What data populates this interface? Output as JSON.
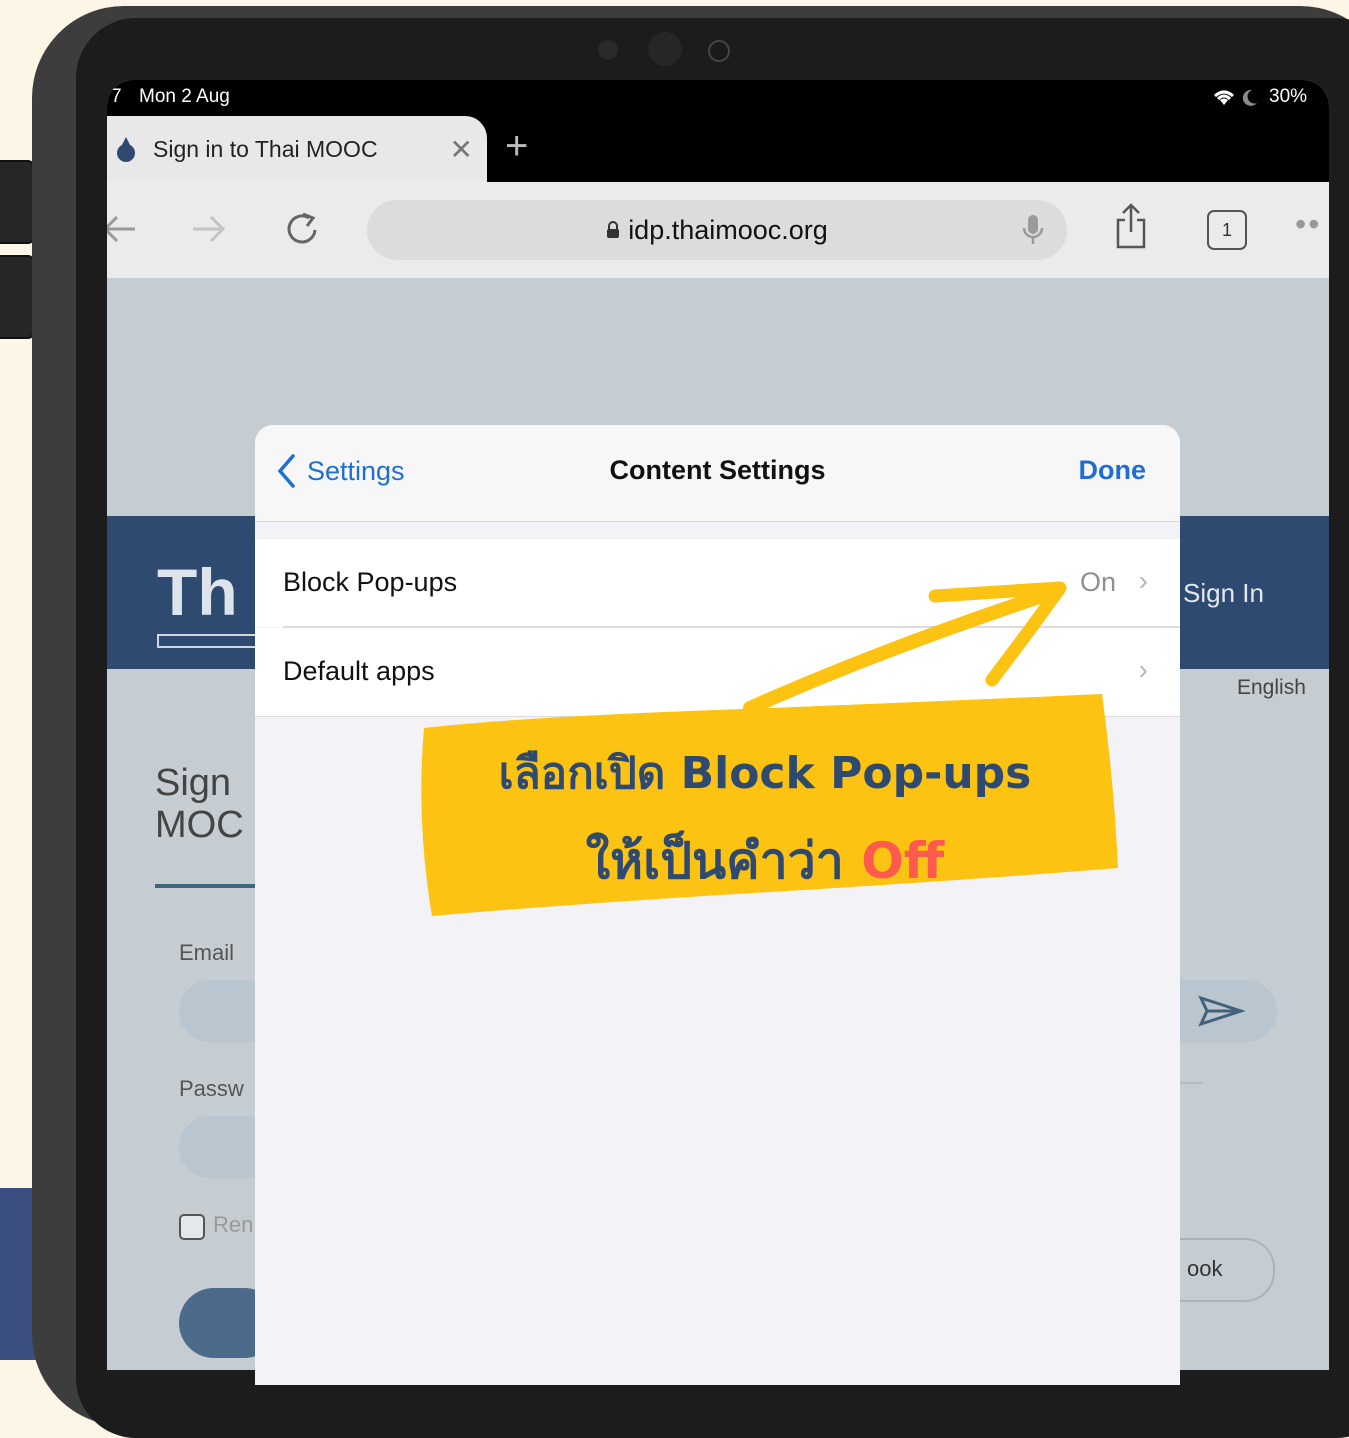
{
  "status_bar": {
    "time_partial": "7",
    "date": "Mon 2 Aug",
    "battery": "30%"
  },
  "browser": {
    "tab_title": "Sign in to Thai MOOC",
    "url": "idp.thaimooc.org",
    "tab_count": "1"
  },
  "background_page": {
    "brand_partial": "Th",
    "signin_link": "Sign In",
    "language": "English",
    "heading_line1": "Sign",
    "heading_line2": "MOC",
    "email_label": "Email",
    "password_label": "Passw",
    "remember_partial": "Ren",
    "facebook_partial": "ook"
  },
  "modal": {
    "back_label": "Settings",
    "title": "Content Settings",
    "done_label": "Done",
    "rows": [
      {
        "label": "Block Pop-ups",
        "value": "On"
      },
      {
        "label": "Default apps",
        "value": ""
      }
    ]
  },
  "annotation": {
    "line1": "เลือกเปิด Block Pop-ups",
    "line2_prefix": "ให้เป็นคำว่า",
    "line2_highlight": "Off",
    "highlight_color": "#ff5a4e",
    "note_color": "#fdc313"
  }
}
